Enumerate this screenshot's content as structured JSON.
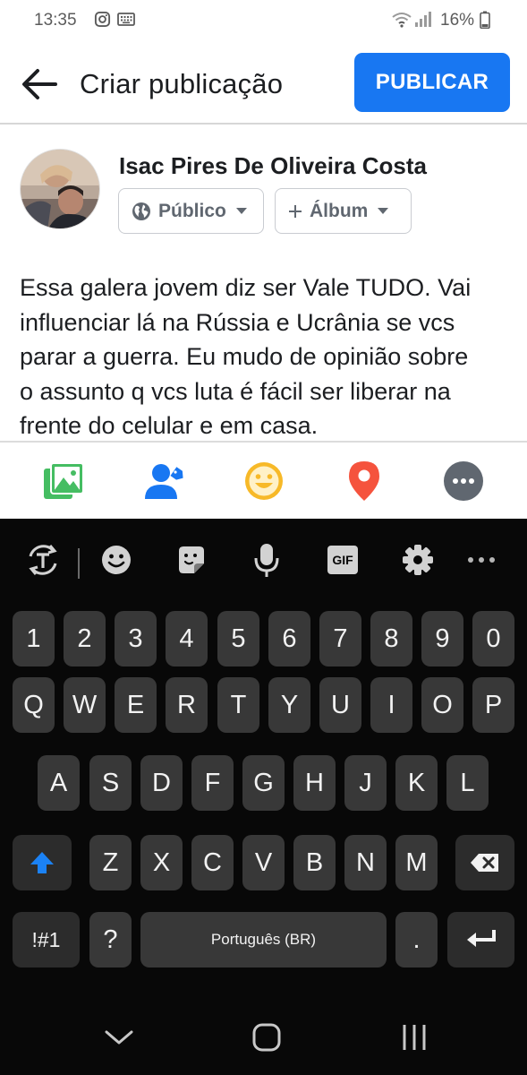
{
  "status_bar": {
    "time": "13:35",
    "battery": "16%",
    "icons": [
      "instagram-icon",
      "keyboard-icon",
      "wifi-icon",
      "signal-icon",
      "battery-icon"
    ]
  },
  "header": {
    "title": "Criar publicação",
    "publish_label": "PUBLICAR",
    "back_icon": "arrow-left-icon"
  },
  "profile": {
    "name": "Isac Pires De Oliveira Costa",
    "audience": "Público",
    "album": "Álbum"
  },
  "post": {
    "text": "Essa galera jovem diz ser Vale TUDO. Vai\ninfluenciar lá na Rússia e Ucrânia  se vcs\nparar a guerra. Eu mudo de opinião sobre\no assunto q vcs luta é fácil ser liberar na\nfrente do celular e em casa."
  },
  "actions": [
    "photo-icon",
    "tag-people-icon",
    "feeling-icon",
    "location-icon",
    "more-icon"
  ],
  "keyboard": {
    "toolbar": [
      "text-translate-icon",
      "emoji-icon",
      "sticker-icon",
      "mic-icon",
      "gif-icon",
      "settings-icon",
      "more-horizontal-icon"
    ],
    "gif_label": "GIF",
    "rows": [
      [
        "1",
        "2",
        "3",
        "4",
        "5",
        "6",
        "7",
        "8",
        "9",
        "0"
      ],
      [
        "Q",
        "W",
        "E",
        "R",
        "T",
        "Y",
        "U",
        "I",
        "O",
        "P"
      ],
      [
        "A",
        "S",
        "D",
        "F",
        "G",
        "H",
        "J",
        "K",
        "L"
      ],
      [
        "Z",
        "X",
        "C",
        "V",
        "B",
        "N",
        "M"
      ]
    ],
    "symbols_label": "!#1",
    "question_label": "?",
    "space_label": "Português (BR)",
    "period_label": "."
  },
  "colors": {
    "accent": "#1877f2",
    "photo": "#45bd62",
    "tag": "#1877f2",
    "feeling": "#f7b928",
    "location": "#f5533d",
    "more": "#606770"
  }
}
